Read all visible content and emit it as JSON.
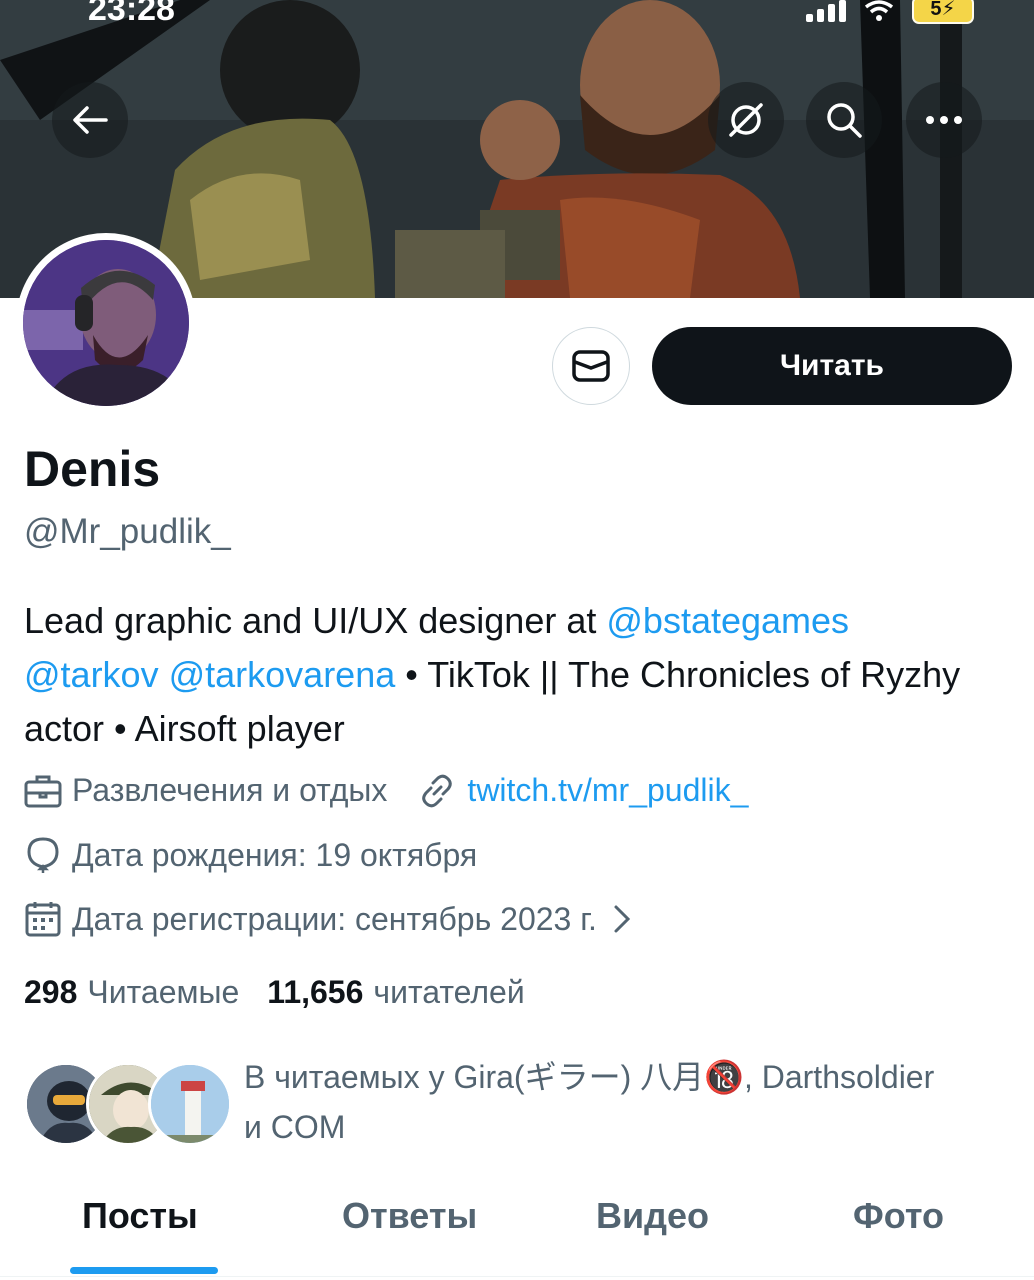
{
  "status_bar": {
    "time": "23:28",
    "battery": "5"
  },
  "header_actions": {
    "back_icon": "arrow-left-icon",
    "grok_icon": "slash-circle-icon",
    "search_icon": "search-icon",
    "more_icon": "more-horizontal-icon"
  },
  "profile": {
    "name": "Denis",
    "handle": "@Mr_pudlik_",
    "follow_label": "Читать",
    "bio": {
      "text1": "Lead graphic and UI/UX designer at ",
      "link1": "@bstategames",
      "link2": "@tarkov",
      "link3": "@tarkovarena",
      "text2": " • TikTok || The Chronicles of Ryzhy actor • Airsoft player"
    },
    "category": "Развлечения и отдых",
    "website": "twitch.tv/mr_pudlik_",
    "birthday": "Дата рождения: 19 октября",
    "joined": "Дата регистрации: сентябрь 2023 г.",
    "following_count": "298",
    "following_label": "Читаемые",
    "followers_count": "11,656",
    "followers_label": "читателей",
    "known_followers": "В читаемых у Gira(ギラー) 八月🔞, Darthsoldier и COM"
  },
  "tabs": [
    {
      "label": "Посты",
      "active": true
    },
    {
      "label": "Ответы",
      "active": false
    },
    {
      "label": "Видео",
      "active": false
    },
    {
      "label": "Фото",
      "active": false
    }
  ],
  "colors": {
    "accent": "#1d9bf0",
    "text": "#0f1419",
    "secondary": "#536471"
  }
}
